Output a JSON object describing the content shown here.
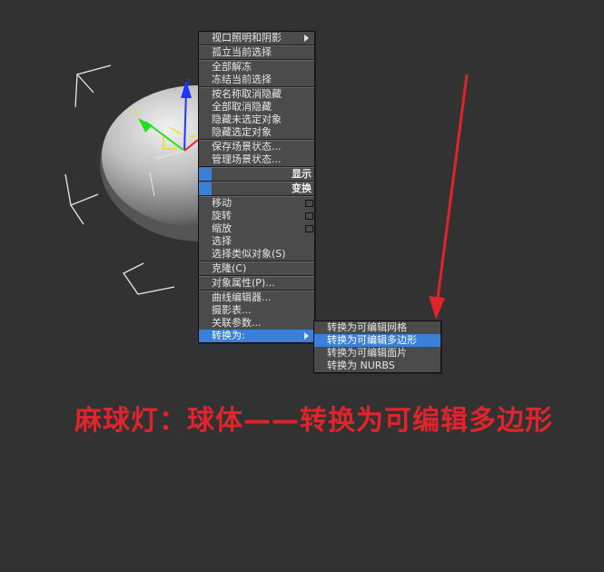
{
  "quad_menu": {
    "items": [
      {
        "label": "视口照明和阴影",
        "type": "submenu"
      },
      {
        "label": "孤立当前选择"
      },
      {
        "label": "全部解冻"
      },
      {
        "label": "冻结当前选择"
      },
      {
        "label": "按名称取消隐藏"
      },
      {
        "label": "全部取消隐藏"
      },
      {
        "label": "隐藏未选定对象"
      },
      {
        "label": "隐藏选定对象"
      },
      {
        "label": "保存场景状态..."
      },
      {
        "label": "管理场景状态..."
      }
    ],
    "display_header": "显示",
    "transform_header": "变换",
    "transform_items": [
      {
        "label": "移动",
        "has_settings": true
      },
      {
        "label": "旋转",
        "has_settings": true
      },
      {
        "label": "缩放",
        "has_settings": true
      },
      {
        "label": "选择"
      },
      {
        "label": "选择类似对象(S)"
      }
    ],
    "clone": "克隆(C)",
    "object_properties": "对象属性(P)...",
    "curve_editor": "曲线编辑器...",
    "dope_sheet": "摄影表...",
    "wire_parameters": "关联参数...",
    "convert_to": "转换为:"
  },
  "convert_submenu": {
    "items": [
      {
        "label": "转换为可编辑网格",
        "highlighted": false
      },
      {
        "label": "转换为可编辑多边形",
        "highlighted": true
      },
      {
        "label": "转换为可编辑面片",
        "highlighted": false
      },
      {
        "label": "转换为 NURBS",
        "highlighted": false
      }
    ]
  },
  "viewport": {
    "gizmo_axes": [
      "x",
      "y",
      "z"
    ],
    "annotation_arrow_color": "#e0242b"
  },
  "caption": "麻球灯：球体——转换为可编辑多边形",
  "colors": {
    "background": "#323232",
    "menu_bg": "#4b4b4b",
    "highlight": "#3a7fd9",
    "caption": "#e0242b"
  }
}
